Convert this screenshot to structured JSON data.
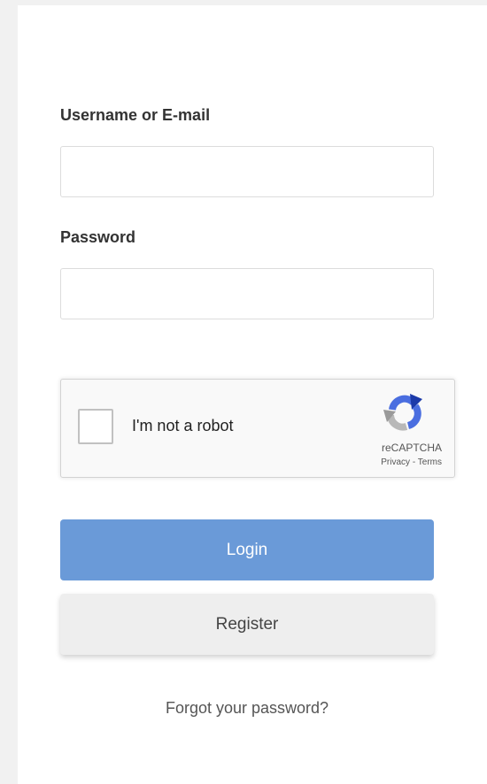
{
  "form": {
    "username_label": "Username or E-mail",
    "username_value": "",
    "password_label": "Password",
    "password_value": ""
  },
  "captcha": {
    "checkbox_label": "I'm not a robot",
    "checked": false,
    "brand": "reCAPTCHA",
    "privacy_link": "Privacy",
    "separator": " - ",
    "terms_link": "Terms",
    "logo_icon": "recaptcha-logo-icon"
  },
  "actions": {
    "login_label": "Login",
    "register_label": "Register",
    "forgot_label": "Forgot your password?"
  },
  "colors": {
    "page_background": "#f1f1f1",
    "panel_background": "#ffffff",
    "login_button": "#6a9ad8",
    "register_button": "#eeeeee",
    "text": "#333333"
  }
}
